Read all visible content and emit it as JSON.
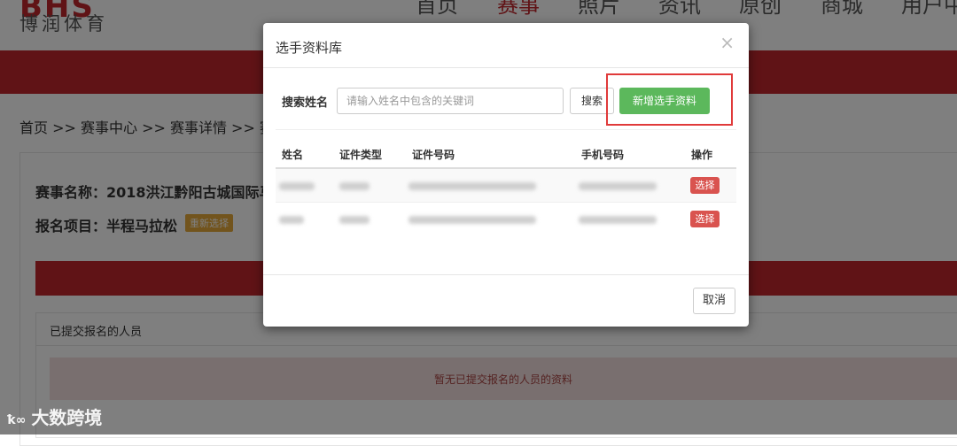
{
  "site": {
    "logo_mark": "BHS",
    "logo_text": "博润体育",
    "nav": [
      "首页",
      "赛事",
      "照片",
      "资讯",
      "原创",
      "商城",
      "用户中"
    ],
    "active_nav": "赛事"
  },
  "page": {
    "breadcrumb": "首页 >> 赛事中心 >> 赛事详情 >> 赛",
    "event_name": "赛事名称：2018洪江黔阳古城国际马",
    "event_item": "报名项目：半程马拉松",
    "reselect_label": "重新选择",
    "submitted_panel_title": "已提交报名的人员",
    "empty_message": "暂无已提交报名的人员的资料"
  },
  "modal": {
    "title": "选手资料库",
    "close_icon": "close-icon",
    "search_label": "搜索姓名",
    "search_placeholder": "请输入姓名中包含的关键词",
    "search_button": "搜索",
    "add_button": "新增选手资料",
    "columns": [
      "姓名",
      "证件类型",
      "证件号码",
      "手机号码",
      "操作"
    ],
    "rows": [
      {
        "choose_label": "选择"
      },
      {
        "choose_label": "选择"
      }
    ],
    "cancel_button": "取消"
  },
  "watermark": "大数跨境",
  "colors": {
    "brand_red": "#c0272d",
    "success_green": "#5cb85c",
    "danger_red": "#d9534f",
    "highlight_red": "#e03a3a",
    "reselect_orange": "#e5a93b"
  }
}
